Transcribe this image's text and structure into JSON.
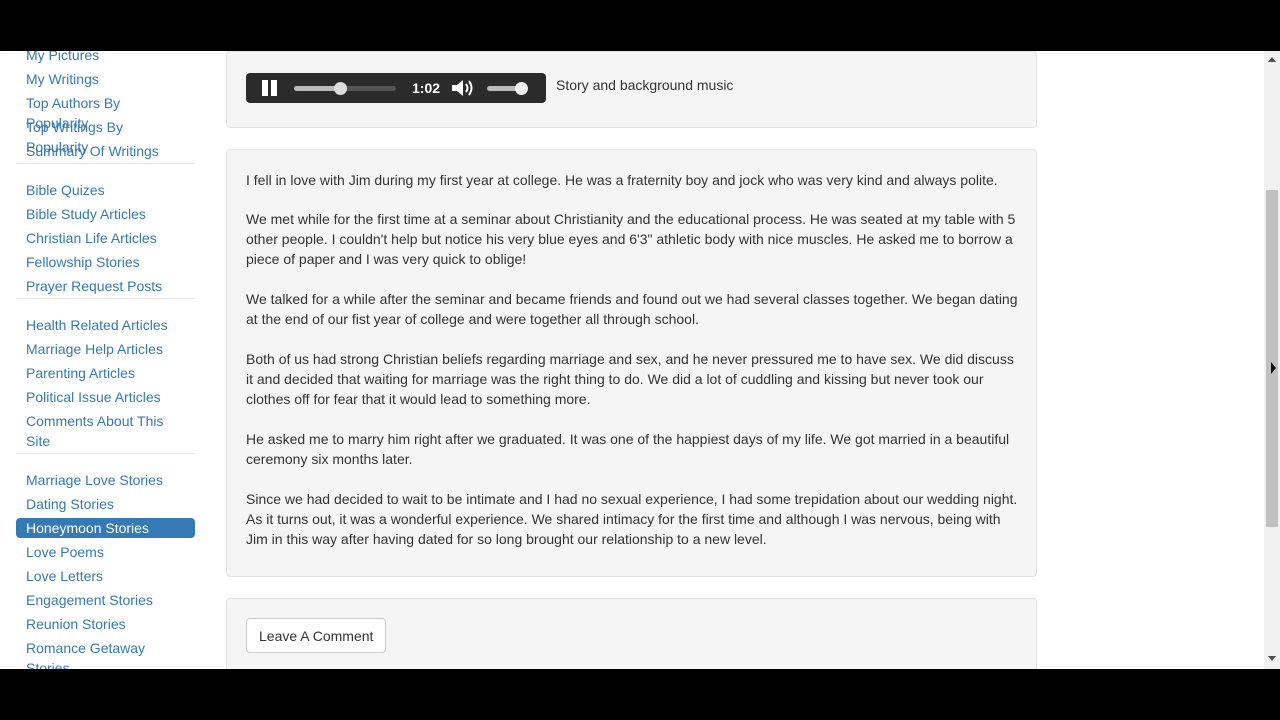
{
  "sidebar": {
    "groups": [
      [
        "My Pictures",
        "My Writings",
        "Top Authors By Popularity",
        "Top Writings By Popularity",
        "Summary Of Writings"
      ],
      [
        "Bible Quizes",
        "Bible Study Articles",
        "Christian Life Articles",
        "Fellowship Stories",
        "Prayer Request Posts"
      ],
      [
        "Health Related Articles",
        "Marriage Help Articles",
        "Parenting Articles",
        "Political Issue Articles",
        "Comments About This Site"
      ],
      [
        "Marriage Love Stories",
        "Dating Stories",
        "Honeymoon Stories",
        "Love Poems",
        "Love Letters",
        "Engagement Stories",
        "Reunion Stories",
        "Romance Getaway Stories"
      ]
    ],
    "active_item": "Honeymoon Stories"
  },
  "player": {
    "elapsed": "1:02",
    "progress": 0.45,
    "volume": 0.9,
    "label": "Story and background music",
    "icons": [
      "pause-icon",
      "volume-icon"
    ]
  },
  "story": {
    "paragraphs": [
      "I fell in love with Jim during my first year at college. He was a fraternity boy and jock who was very kind and always polite.",
      "We met while for the first time at a seminar about Christianity and the educational process. He was seated at my table with 5 other people. I couldn't help but notice his very blue eyes and 6'3\" athletic body with nice muscles. He asked me to borrow a piece of paper and I was very quick to oblige!",
      "We talked for a while after the seminar and became friends and found out we had several classes together. We began dating at the end of our fist year of college and were together all through school.",
      "Both of us had strong Christian beliefs regarding marriage and sex, and he never pressured me to have sex. We did discuss it and decided that waiting for marriage was the right thing to do. We did a lot of cuddling and kissing but never took our clothes off for fear that it would lead to something more.",
      "He asked me to marry him right after we graduated. It was one of the happiest days of my life. We got married in a beautiful ceremony six months later.",
      "Since we had decided to wait to be intimate and I had no sexual experience, I had some trepidation about our wedding night. As it turns out, it was a wonderful experience. We shared intimacy for the first time and although I was nervous, being with Jim in this way after having dated for so long brought our relationship to a new level."
    ]
  },
  "comment": {
    "button_label": "Leave A Comment"
  },
  "colors": {
    "link": "#337ab7",
    "active_bg": "#337ab7",
    "panel_bg": "#f5f5f5",
    "player_bg": "#2b2b2b"
  }
}
